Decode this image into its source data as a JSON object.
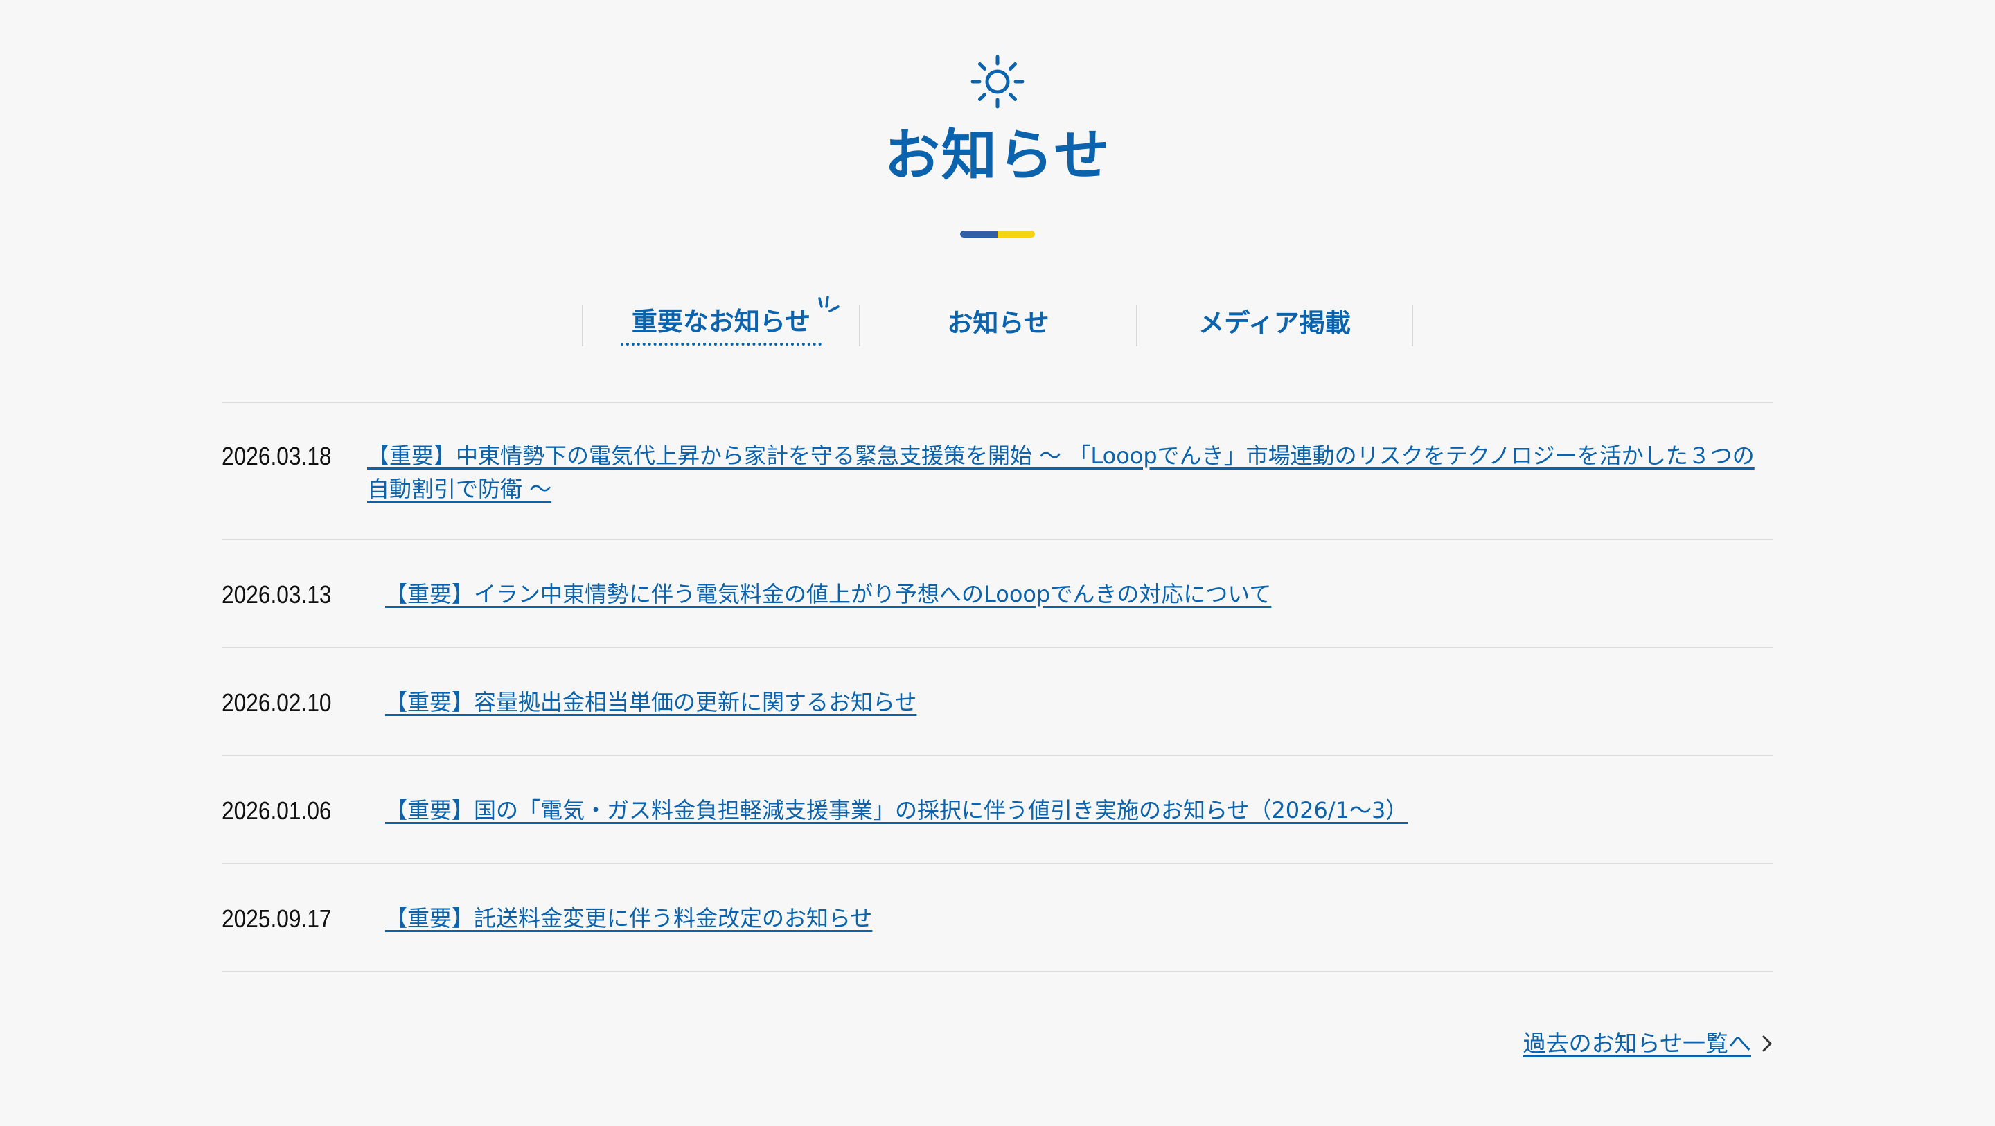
{
  "header": {
    "title": "お知らせ",
    "icon": "sun-icon",
    "accent_colors": [
      "#2f5fa8",
      "#f6d313"
    ],
    "brand_color": "#0b62ad"
  },
  "tabs": [
    {
      "label": "重要なお知らせ",
      "active": true
    },
    {
      "label": "お知らせ",
      "active": false
    },
    {
      "label": "メディア掲載",
      "active": false
    }
  ],
  "news": [
    {
      "date": "2026.03.18",
      "title": "【重要】中東情勢下の電気代上昇から家計を守る緊急支援策を開始 ～ 「Looopでんき」市場連動のリスクをテクノロジーを活かした３つの自動割引で防衛 ～"
    },
    {
      "date": "2026.03.13",
      "title": "【重要】イラン中東情勢に伴う電気料金の値上がり予想へのLooopでんきの対応について"
    },
    {
      "date": "2026.02.10",
      "title": "【重要】容量拠出金相当単価の更新に関するお知らせ"
    },
    {
      "date": "2026.01.06",
      "title": "【重要】国の「電気・ガス料金負担軽減支援事業」の採択に伴う値引き実施のお知らせ（2026/1～3）"
    },
    {
      "date": "2025.09.17",
      "title": "【重要】託送料金変更に伴う料金改定のお知らせ"
    }
  ],
  "more": {
    "label": "過去のお知らせ一覧へ",
    "icon": "chevron-right-icon"
  }
}
